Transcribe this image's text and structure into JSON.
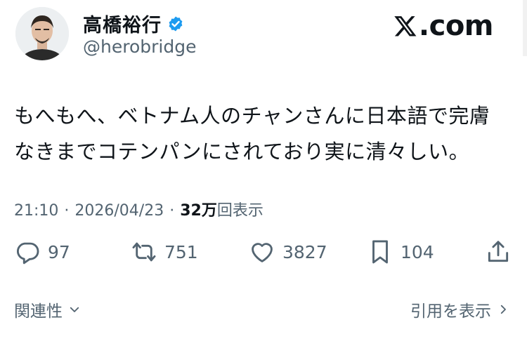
{
  "author": {
    "display_name": "高橋裕行",
    "handle": "@herobridge",
    "verified": true
  },
  "brand": {
    "text": ".com",
    "icon": "x-logo-icon"
  },
  "post": {
    "text_line1": "もへもへ、ベトナム人のチャンさんに日本語で完膚",
    "text_line2": "なきまでコテンパンにされており実に清々しい。",
    "time": "21:10",
    "date": "2026/04/23",
    "views_count": "32万",
    "views_label": "回表示",
    "separator": "·"
  },
  "actions": {
    "replies": "97",
    "reposts": "751",
    "likes": "3827",
    "bookmarks": "104"
  },
  "footer": {
    "related": "関連性",
    "quotes": "引用を表示"
  },
  "colors": {
    "text": "#0f1419",
    "secondary": "#536471",
    "verified": "#1d9bf0"
  }
}
